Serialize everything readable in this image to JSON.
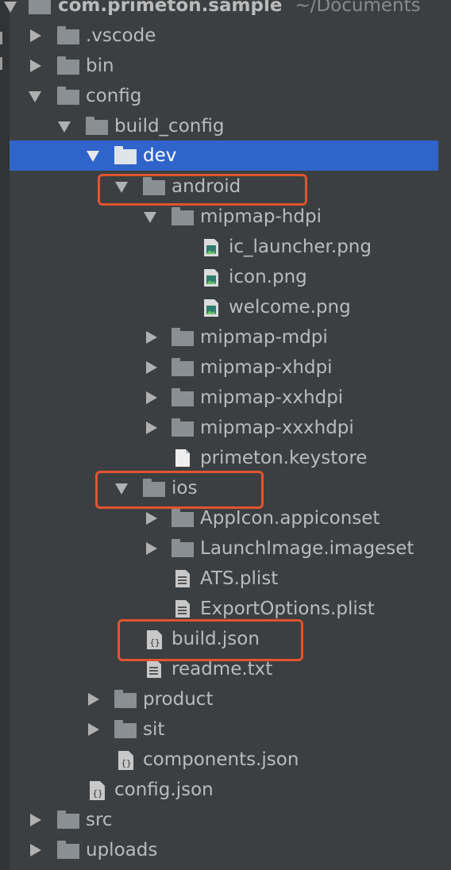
{
  "project": {
    "root_name": "com.primeton.sample",
    "root_path": "~/Documents"
  },
  "tree": {
    "vscode": ".vscode",
    "bin": "bin",
    "config": "config",
    "build_config": "build_config",
    "dev": "dev",
    "android": "android",
    "mipmap_hdpi": "mipmap-hdpi",
    "ic_launcher": "ic_launcher.png",
    "icon_png": "icon.png",
    "welcome_png": "welcome.png",
    "mipmap_mdpi": "mipmap-mdpi",
    "mipmap_xhdpi": "mipmap-xhdpi",
    "mipmap_xxhdpi": "mipmap-xxhdpi",
    "mipmap_xxxhdpi": "mipmap-xxxhdpi",
    "keystore": "primeton.keystore",
    "ios": "ios",
    "appicon": "AppIcon.appiconset",
    "launchimage": "LaunchImage.imageset",
    "ats_plist": "ATS.plist",
    "export_plist": "ExportOptions.plist",
    "build_json": "build.json",
    "readme": "readme.txt",
    "product": "product",
    "sit": "sit",
    "components_json": "components.json",
    "config_json": "config.json",
    "src": "src",
    "uploads": "uploads"
  },
  "colors": {
    "background": "#3c3f41",
    "selection": "#2f65ca",
    "highlight_box": "#e2542f",
    "folder_icon": "#8a8f93",
    "text": "#bbbbbb"
  }
}
